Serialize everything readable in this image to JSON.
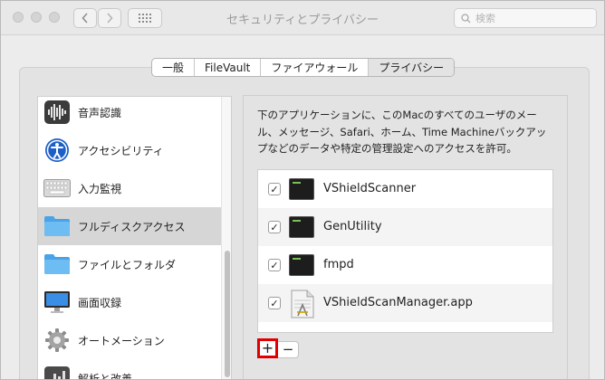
{
  "window": {
    "title": "セキュリティとプライバシー",
    "search_placeholder": "検索"
  },
  "tabs": [
    {
      "label": "一般",
      "active": false
    },
    {
      "label": "FileVault",
      "active": false
    },
    {
      "label": "ファイアウォール",
      "active": false
    },
    {
      "label": "プライバシー",
      "active": true
    }
  ],
  "sidebar": {
    "items": [
      {
        "label": "音声認識",
        "icon": "waveform-icon"
      },
      {
        "label": "アクセシビリティ",
        "icon": "accessibility-icon"
      },
      {
        "label": "入力監視",
        "icon": "keyboard-icon"
      },
      {
        "label": "フルディスクアクセス",
        "icon": "folder-icon",
        "selected": true
      },
      {
        "label": "ファイルとフォルダ",
        "icon": "folder-icon"
      },
      {
        "label": "画面収録",
        "icon": "display-icon"
      },
      {
        "label": "オートメーション",
        "icon": "gear-icon"
      },
      {
        "label": "解析と改善",
        "icon": "chart-icon"
      }
    ]
  },
  "main": {
    "description": "下のアプリケーションに、このMacのすべてのユーザのメール、メッセージ、Safari、ホーム、Time Machineバックアップなどのデータや特定の管理設定へのアクセスを許可。",
    "apps": [
      {
        "name": "VShieldScanner",
        "checked": true,
        "icon": "terminal-icon"
      },
      {
        "name": "GenUtility",
        "checked": true,
        "icon": "terminal-icon"
      },
      {
        "name": "fmpd",
        "checked": true,
        "icon": "terminal-icon"
      },
      {
        "name": "VShieldScanManager.app",
        "checked": true,
        "icon": "app-icon"
      }
    ],
    "add_label": "+",
    "remove_label": "−",
    "check_mark": "✓"
  },
  "colors": {
    "highlight_border": "#e00000",
    "selected_row": "#d6d6d6",
    "folder_blue": "#5ab1ef"
  }
}
